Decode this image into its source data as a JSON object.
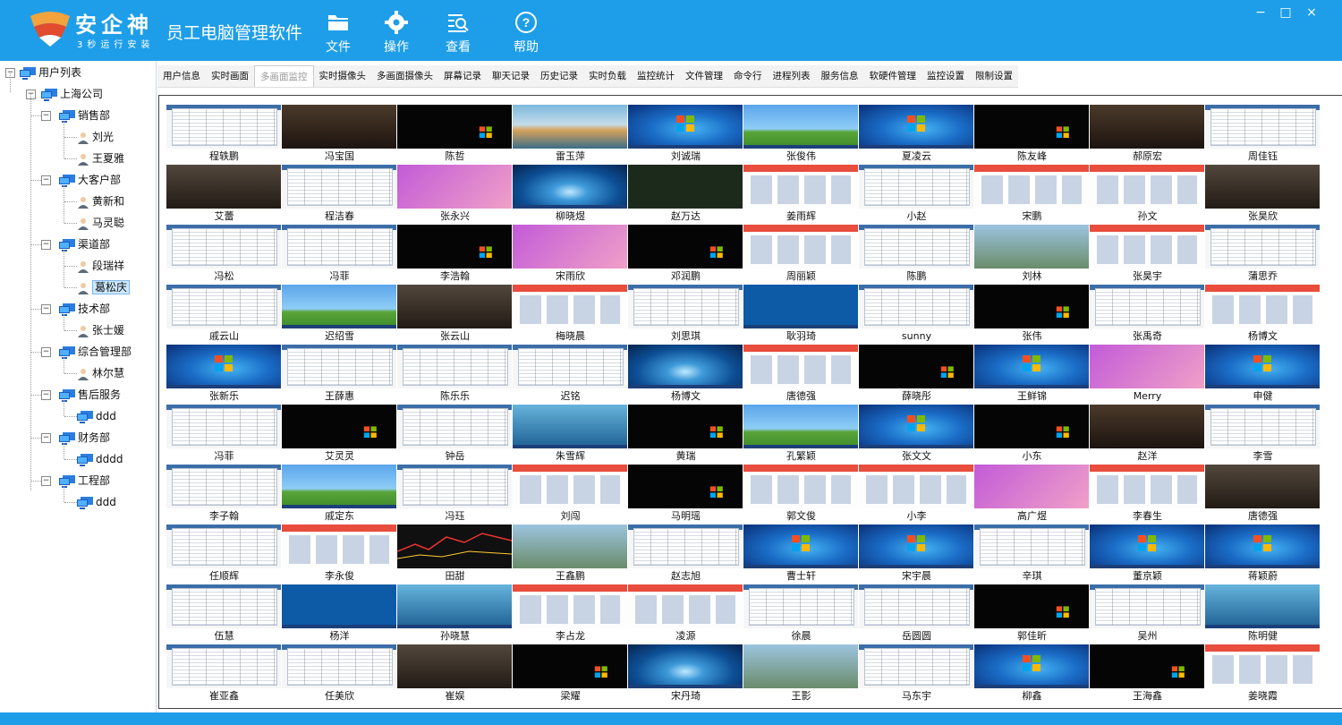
{
  "app": {
    "logo_text": "安企神",
    "logo_sub": "3秒运行安装",
    "title": "员工电脑管理软件"
  },
  "toolbar": [
    {
      "label": "文件",
      "icon": "folder-icon"
    },
    {
      "label": "操作",
      "icon": "gear-icon"
    },
    {
      "label": "查看",
      "icon": "search-list-icon"
    },
    {
      "label": "帮助",
      "icon": "help-icon"
    }
  ],
  "window_controls": {
    "minimize": "−",
    "maximize": "□",
    "close": "×"
  },
  "tree": {
    "root": "用户列表",
    "company": "上海公司",
    "departments": [
      {
        "name": "销售部",
        "children": [
          "刘光",
          "王夏雅"
        ]
      },
      {
        "name": "大客户部",
        "children": [
          "黄新和",
          "马灵聪"
        ]
      },
      {
        "name": "渠道部",
        "children": [
          "段瑞祥",
          "葛松庆"
        ]
      },
      {
        "name": "技术部",
        "children": [
          "张士媛"
        ]
      },
      {
        "name": "综合管理部",
        "children": [
          "林尔慧"
        ]
      },
      {
        "name": "售后服务",
        "children": [
          "ddd"
        ]
      },
      {
        "name": "财务部",
        "children": [
          "dddd"
        ]
      },
      {
        "name": "工程部",
        "children": [
          "ddd"
        ]
      }
    ],
    "selected": "葛松庆"
  },
  "tabs": [
    "用户信息",
    "实时画面",
    "多画面监控",
    "实时摄像头",
    "多画面摄像头",
    "屏幕记录",
    "聊天记录",
    "历史记录",
    "实时负载",
    "监控统计",
    "文件管理",
    "命令行",
    "进程列表",
    "服务信息",
    "软硬件管理",
    "监控设置",
    "限制设置"
  ],
  "active_tab": "多画面监控",
  "screens": [
    {
      "name": "程轶鹏",
      "t": "office"
    },
    {
      "name": "冯宝国",
      "t": "game"
    },
    {
      "name": "陈哲",
      "t": "black"
    },
    {
      "name": "雷玉萍",
      "t": "lake"
    },
    {
      "name": "刘诚瑞",
      "t": "win7"
    },
    {
      "name": "张俊伟",
      "t": "xp"
    },
    {
      "name": "夏凌云",
      "t": "win7"
    },
    {
      "name": "陈友峰",
      "t": "black"
    },
    {
      "name": "郝原宏",
      "t": "game"
    },
    {
      "name": "周佳钰",
      "t": "office"
    },
    {
      "name": "艾蕾",
      "t": "film"
    },
    {
      "name": "程洁春",
      "t": "office"
    },
    {
      "name": "张永兴",
      "t": "purple"
    },
    {
      "name": "柳晓煜",
      "t": "drop"
    },
    {
      "name": "赵万达",
      "t": "dark"
    },
    {
      "name": "姜雨辉",
      "t": "web"
    },
    {
      "name": "小赵",
      "t": "office"
    },
    {
      "name": "宋鹏",
      "t": "web"
    },
    {
      "name": "孙文",
      "t": "web"
    },
    {
      "name": "张昊欣",
      "t": "film"
    },
    {
      "name": "冯松",
      "t": "office"
    },
    {
      "name": "冯菲",
      "t": "office"
    },
    {
      "name": "李浩翰",
      "t": "black"
    },
    {
      "name": "宋雨欣",
      "t": "purple"
    },
    {
      "name": "邓润鹏",
      "t": "black"
    },
    {
      "name": "周丽颖",
      "t": "web"
    },
    {
      "name": "陈鹏",
      "t": "office"
    },
    {
      "name": "刘林",
      "t": "city"
    },
    {
      "name": "张昊宇",
      "t": "web"
    },
    {
      "name": "蒲思乔",
      "t": "office"
    },
    {
      "name": "戚云山",
      "t": "office"
    },
    {
      "name": "迟绍雪",
      "t": "xp"
    },
    {
      "name": "张云山",
      "t": "film"
    },
    {
      "name": "梅晓晨",
      "t": "web"
    },
    {
      "name": "刘思琪",
      "t": "office"
    },
    {
      "name": "耿羽琦",
      "t": "bluedesk"
    },
    {
      "name": "sunny",
      "t": "office"
    },
    {
      "name": "张伟",
      "t": "black"
    },
    {
      "name": "张禹奇",
      "t": "office"
    },
    {
      "name": "杨博文",
      "t": "web"
    },
    {
      "name": "张新乐",
      "t": "win7"
    },
    {
      "name": "王薛惠",
      "t": "office"
    },
    {
      "name": "陈乐乐",
      "t": "office"
    },
    {
      "name": "迟铭",
      "t": "office"
    },
    {
      "name": "杨博文",
      "t": "drop"
    },
    {
      "name": "唐德强",
      "t": "web"
    },
    {
      "name": "薛晓彤",
      "t": "black"
    },
    {
      "name": "王鲜锦",
      "t": "win7"
    },
    {
      "name": "Merry",
      "t": "purple"
    },
    {
      "name": "申健",
      "t": "win7"
    },
    {
      "name": "冯菲",
      "t": "office"
    },
    {
      "name": "艾灵灵",
      "t": "black"
    },
    {
      "name": "钟岳",
      "t": "office"
    },
    {
      "name": "朱雪辉",
      "t": "aqua"
    },
    {
      "name": "黄瑞",
      "t": "black"
    },
    {
      "name": "孔繁颖",
      "t": "xp"
    },
    {
      "name": "张文文",
      "t": "win7"
    },
    {
      "name": "小东",
      "t": "black"
    },
    {
      "name": "赵洋",
      "t": "game"
    },
    {
      "name": "李雪",
      "t": "office"
    },
    {
      "name": "李子翰",
      "t": "office"
    },
    {
      "name": "戚定东",
      "t": "xp"
    },
    {
      "name": "冯珏",
      "t": "office"
    },
    {
      "name": "刘闯",
      "t": "web"
    },
    {
      "name": "马明瑶",
      "t": "black"
    },
    {
      "name": "郭文俊",
      "t": "web"
    },
    {
      "name": "小李",
      "t": "web"
    },
    {
      "name": "高广煜",
      "t": "purple"
    },
    {
      "name": "李春生",
      "t": "web"
    },
    {
      "name": "唐德强",
      "t": "film"
    },
    {
      "name": "任顺辉",
      "t": "office"
    },
    {
      "name": "李永俊",
      "t": "web"
    },
    {
      "name": "田甜",
      "t": "stock"
    },
    {
      "name": "王鑫鹏",
      "t": "city"
    },
    {
      "name": "赵志旭",
      "t": "office"
    },
    {
      "name": "曹士轩",
      "t": "win7"
    },
    {
      "name": "宋宇晨",
      "t": "win7"
    },
    {
      "name": "辛琪",
      "t": "office"
    },
    {
      "name": "董京颖",
      "t": "win7"
    },
    {
      "name": "蒋颖蔚",
      "t": "win7"
    },
    {
      "name": "伍慧",
      "t": "office"
    },
    {
      "name": "杨洋",
      "t": "bluedesk"
    },
    {
      "name": "孙晓慧",
      "t": "aqua"
    },
    {
      "name": "李占龙",
      "t": "web"
    },
    {
      "name": "凌源",
      "t": "web"
    },
    {
      "name": "徐晨",
      "t": "office"
    },
    {
      "name": "岳圆圆",
      "t": "office"
    },
    {
      "name": "郭佳昕",
      "t": "black"
    },
    {
      "name": "吴州",
      "t": "office"
    },
    {
      "name": "陈明健",
      "t": "aqua"
    },
    {
      "name": "崔亚鑫",
      "t": "office"
    },
    {
      "name": "任美欣",
      "t": "office"
    },
    {
      "name": "崔娱",
      "t": "film"
    },
    {
      "name": "梁耀",
      "t": "black"
    },
    {
      "name": "宋丹琦",
      "t": "drop"
    },
    {
      "name": "王影",
      "t": "city"
    },
    {
      "name": "马东宇",
      "t": "office"
    },
    {
      "name": "柳鑫",
      "t": "win7"
    },
    {
      "name": "王海鑫",
      "t": "black"
    },
    {
      "name": "姜晓霞",
      "t": "web"
    }
  ]
}
